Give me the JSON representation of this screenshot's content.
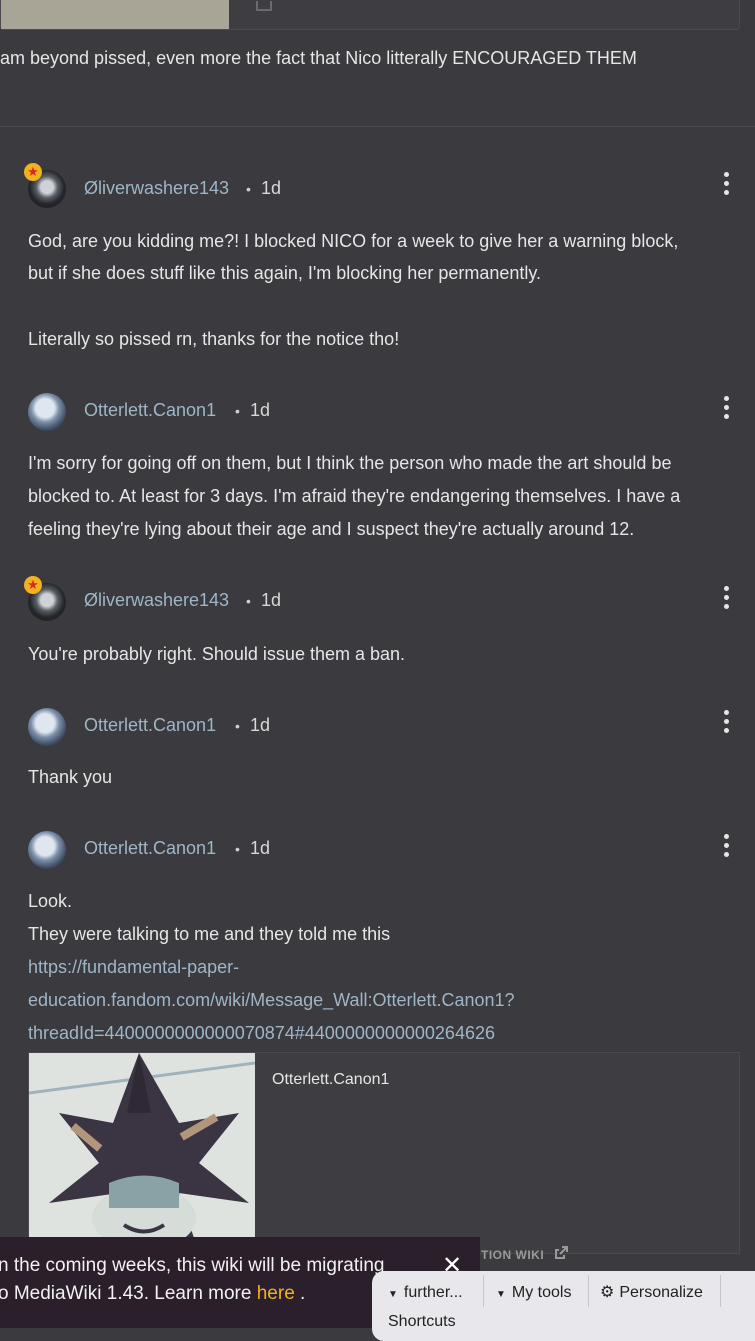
{
  "top_post": {
    "text": "am beyond pissed, even more the fact that Nico litterally ENCOURAGED THEM"
  },
  "comments": [
    {
      "username": "Øliverwashere143",
      "time": "1d",
      "badge": "★",
      "lines": [
        "God, are you kidding me?! I blocked NICO for a week to give her a warning block,",
        "but if she does stuff like this again, I'm blocking her permanently.",
        "",
        "Literally so pissed rn, thanks for the notice tho!"
      ]
    },
    {
      "username": "Otterlett.Canon1",
      "time": "1d",
      "lines": [
        "I'm sorry for going off on them, but I think the person who made the art should be",
        "blocked to. At least for 3 days. I'm afraid they're endangering themselves. I have a",
        "feeling they're lying about their age and I suspect they're actually around 12."
      ]
    },
    {
      "username": "Øliverwashere143",
      "time": "1d",
      "badge": "★",
      "lines": [
        "You're probably right. Should issue them a ban."
      ]
    },
    {
      "username": "Otterlett.Canon1",
      "time": "1d",
      "lines": [
        "Thank you"
      ]
    },
    {
      "username": "Otterlett.Canon1",
      "time": "1d",
      "lines": [
        "Look.",
        "They were talking to me and they told me this"
      ],
      "link_lines": [
        "https://fundamental-paper-",
        "education.fandom.com/wiki/Message_Wall:Otterlett.Canon1?",
        "threadId=4400000000000070874#4400000000000264626"
      ]
    }
  ],
  "separator": "•",
  "preview": {
    "title": "Otterlett.Canon1",
    "site": "TION WIKI"
  },
  "banner": {
    "line1": "n the coming weeks, this wiki will be migrating",
    "line2_prefix": "o MediaWiki 1.43. Learn more ",
    "link": "here",
    "line2_suffix": " .",
    "close": "✕"
  },
  "toolbar": {
    "further": "further...",
    "my_tools": "My tools",
    "personalize": "Personalize",
    "shortcuts": "Shortcuts"
  }
}
